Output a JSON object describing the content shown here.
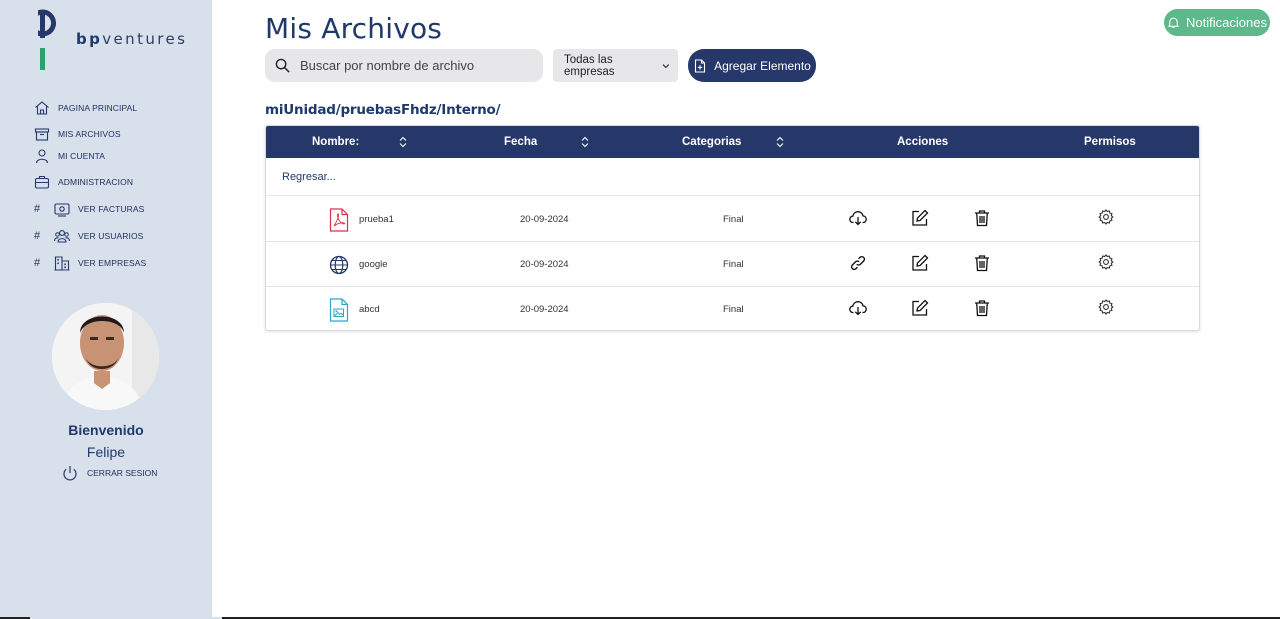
{
  "brand": {
    "prefix": "bp",
    "suffix": "ventures"
  },
  "sidebar": {
    "items": [
      {
        "label": "PAGINA PRINCIPAL",
        "icon": "home-icon"
      },
      {
        "label": "MIS ARCHIVOS",
        "icon": "archive-icon"
      },
      {
        "label": "MI CUENTA",
        "icon": "user-icon"
      },
      {
        "label": "ADMINISTRACION",
        "icon": "briefcase-icon"
      },
      {
        "label": "VER FACTURAS",
        "icon": "invoice-icon",
        "hash": "#"
      },
      {
        "label": "VER USUARIOS",
        "icon": "users-icon",
        "hash": "#"
      },
      {
        "label": "VER EMPRESAS",
        "icon": "building-icon",
        "hash": "#"
      }
    ],
    "welcome": "Bienvenido",
    "user_name": "Felipe",
    "logout_label": "CERRAR SESION"
  },
  "header": {
    "title": "Mis Archivos",
    "notifications_label": "Notificaciones"
  },
  "toolbar": {
    "search_placeholder": "Buscar por nombre de archivo",
    "company_filter": "Todas las empresas",
    "add_label": "Agregar Elemento"
  },
  "breadcrumb": "miUnidad/pruebasFhdz/Interno/",
  "table": {
    "columns": [
      "Nombre:",
      "Fecha",
      "Categorias",
      "Acciones",
      "Permisos"
    ],
    "back_label": "Regresar...",
    "rows": [
      {
        "name": "prueba1",
        "date": "20-09-2024",
        "category": "Final",
        "type_icon": "pdf-icon",
        "primary_action_icon": "download-icon"
      },
      {
        "name": "google",
        "date": "20-09-2024",
        "category": "Final",
        "type_icon": "globe-icon",
        "primary_action_icon": "link-icon"
      },
      {
        "name": "abcd",
        "date": "20-09-2024",
        "category": "Final",
        "type_icon": "image-file-icon",
        "primary_action_icon": "download-icon"
      }
    ]
  },
  "colors": {
    "sidebar_bg": "#d8e0ec",
    "primary": "#26386a",
    "notification": "#5db88c",
    "pdf_red": "#d9334a",
    "image_teal": "#2aa7c9",
    "logo_green": "#2e9e6a"
  }
}
